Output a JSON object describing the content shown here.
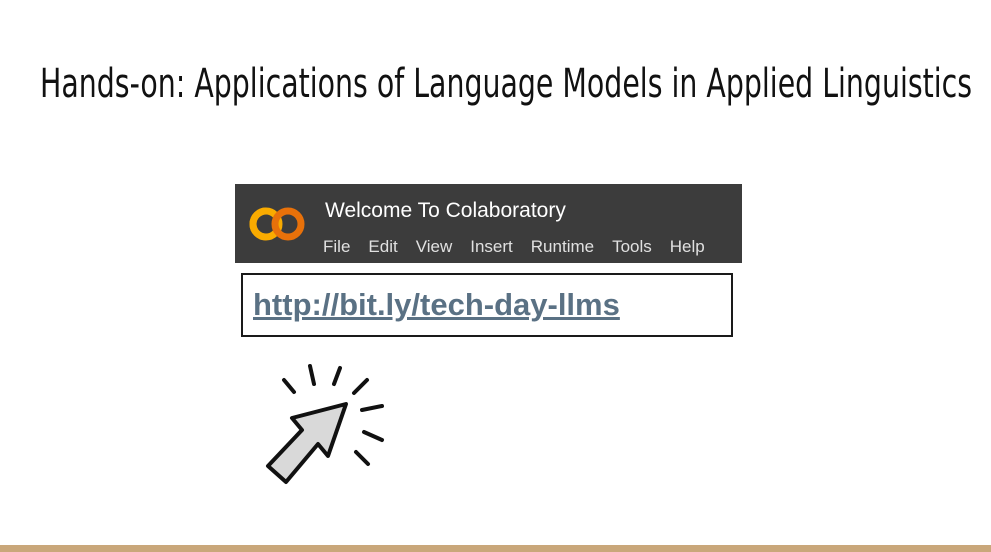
{
  "slide": {
    "title": "Hands-on: Applications of Language Models in Applied Linguistics"
  },
  "colab": {
    "logo_text": "CO",
    "window_title": "Welcome To Colaboratory",
    "menu": [
      "File",
      "Edit",
      "View",
      "Insert",
      "Runtime",
      "Tools",
      "Help"
    ],
    "header_color": "#3c3c3c",
    "logo_color": "#f9ab00",
    "icon": "colab-logo-icon"
  },
  "link": {
    "url_text": "http://bit.ly/tech-day-llms",
    "color": "#5a7184"
  },
  "pointer": {
    "icon": "click-cursor-icon",
    "fill_color": "#d9d9d9"
  },
  "footer": {
    "accent_color": "#c9a77a"
  }
}
